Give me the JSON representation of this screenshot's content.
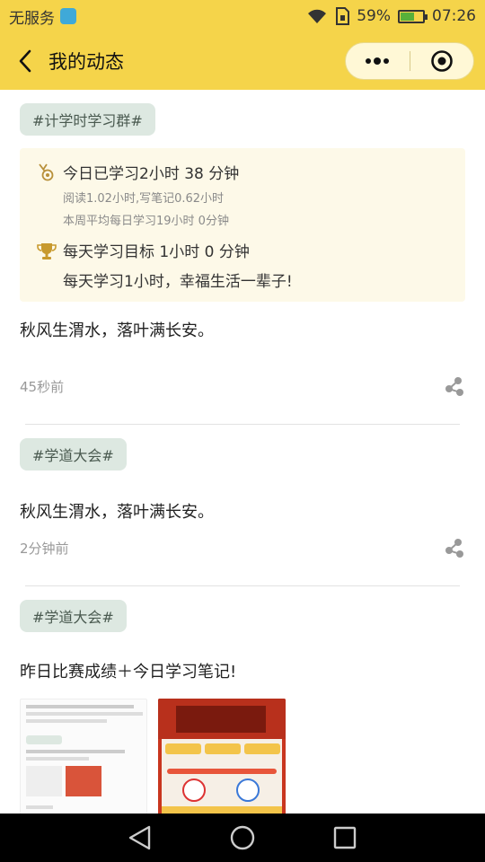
{
  "status_bar": {
    "carrier": "无服务",
    "battery_percent": "59%",
    "battery_level": 0.59,
    "time": "07:26",
    "icons": [
      "app-badge-icon",
      "wifi-icon",
      "sim-icon",
      "battery-icon"
    ]
  },
  "nav": {
    "title": "我的动态",
    "back_icon": "chevron-left-icon",
    "more_icon": "more-dots-icon",
    "close_icon": "target-circle-icon"
  },
  "posts": [
    {
      "tag": "#计学时学习群#",
      "study_card": {
        "today_label": "今日已学习2小时 38 分钟",
        "detail_line1": "阅读1.02小时,写笔记0.62小时",
        "detail_line2": "本周平均每日学习19小时 0分钟",
        "goal_label": "每天学习目标 1小时 0 分钟",
        "goal_motto": "每天学习1小时，幸福生活一辈子!"
      },
      "text": "秋风生渭水，落叶满长安。",
      "time": "45秒前"
    },
    {
      "tag": "#学道大会#",
      "text": "秋风生渭水，落叶满长安。",
      "time": "2分钟前"
    },
    {
      "tag": "#学道大会#",
      "text": "昨日比赛成绩＋今日学习笔记!",
      "images": [
        "post-screenshot-thumbnail",
        "competition-screenshot-thumbnail"
      ]
    }
  ]
}
